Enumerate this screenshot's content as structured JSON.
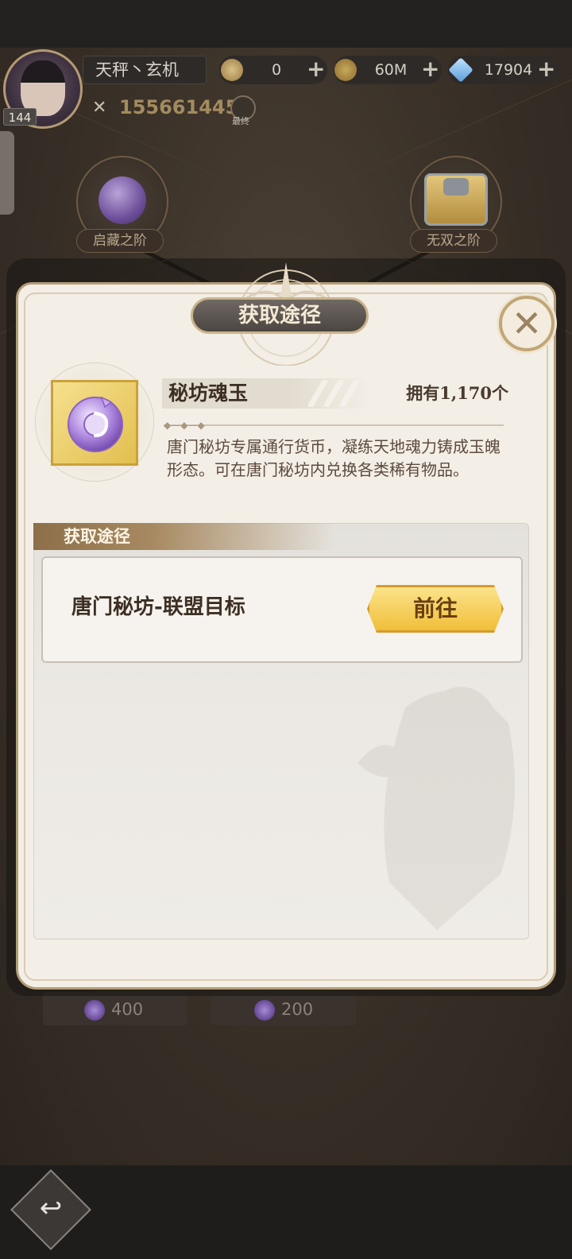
{
  "player": {
    "name": "天秤丶玄机",
    "level": "144",
    "power": "155661445",
    "search_label": "最终"
  },
  "resources": [
    {
      "name": "coin",
      "value": "0",
      "icon": "gold-coin-icon"
    },
    {
      "name": "money",
      "value": "60M",
      "icon": "money-coin-icon"
    },
    {
      "name": "diamond",
      "value": "17904",
      "icon": "diamond-icon"
    }
  ],
  "stages": [
    {
      "label": "启藏之阶"
    },
    {
      "label": "无双之阶"
    }
  ],
  "prices": [
    {
      "value": "400"
    },
    {
      "value": "200"
    }
  ],
  "dialog": {
    "title": "获取途径",
    "item": {
      "name": "秘坊魂玉",
      "owned": "拥有1,170个",
      "description": "唐门秘坊专属通行货币，凝练天地魂力铸成玉魄形态。可在唐门秘坊内兑换各类稀有物品。"
    },
    "source_header": "获取途径",
    "sources": [
      {
        "label": "唐门秘坊-联盟目标",
        "button": "前往"
      }
    ]
  },
  "colors": {
    "accent_gold": "#f0bf3a",
    "dialog_bg": "#f3eee6",
    "title_plate": "#4c4642"
  }
}
